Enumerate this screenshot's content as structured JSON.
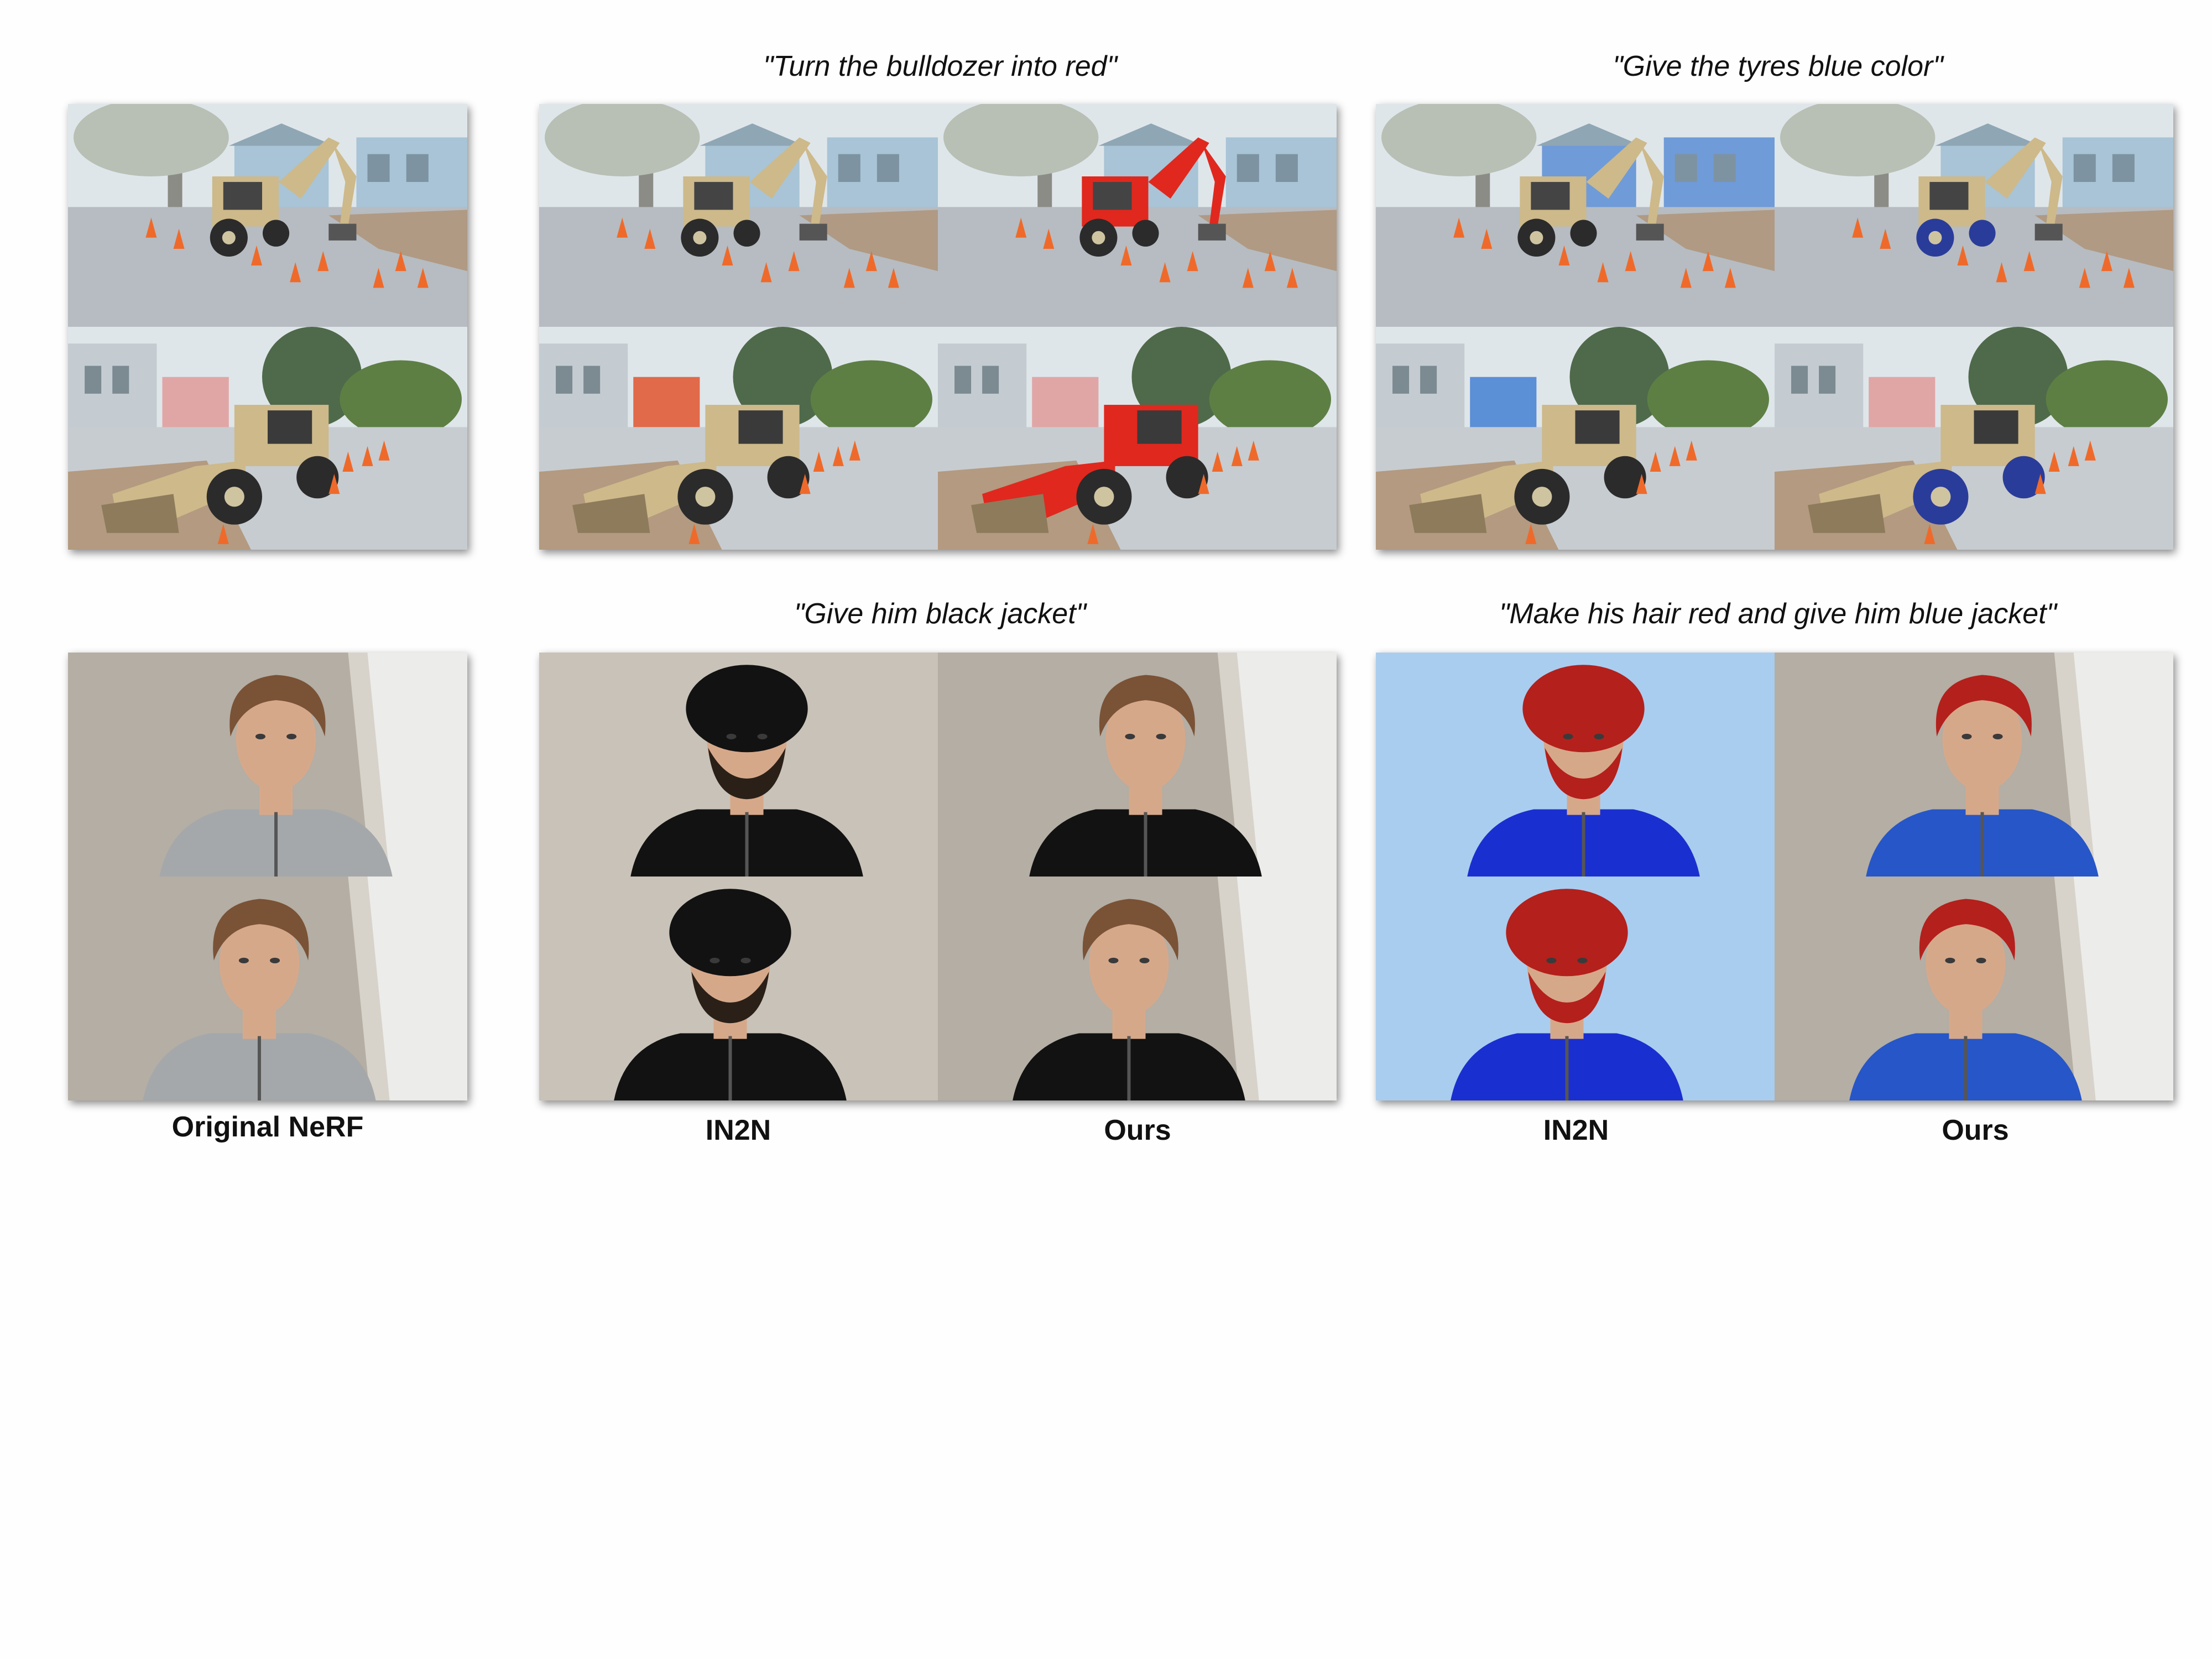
{
  "prompts": [
    "\"Turn the bulldozer into red\"",
    "\"Give the tyres blue color\"",
    "\"Give him black jacket\"",
    "\"Make his hair red and give him blue jacket\""
  ],
  "column_labels": [
    "Original NeRF",
    "IN2N",
    "Ours",
    "IN2N",
    "Ours"
  ],
  "colors": {
    "sky": "#dfe6ea",
    "house_blue": "#a8c4d6",
    "road": "#b6bcc1",
    "bulldozer_tan": "#cdb98a",
    "bulldozer_red": "#e0281e",
    "tyre_blue": "#2a3c9a",
    "cone_orange": "#ef6a2a",
    "concrete": "#b4aea4",
    "skin": "#d6a88a",
    "hair_brown": "#7a5236",
    "hair_red": "#b4201c",
    "sweater_grey": "#a5a8aa",
    "jacket_black": "#121212",
    "jacket_blue": "#2656c8",
    "jacket_royal": "#1a2fd0",
    "bg_lightblue": "#a9cdef"
  }
}
